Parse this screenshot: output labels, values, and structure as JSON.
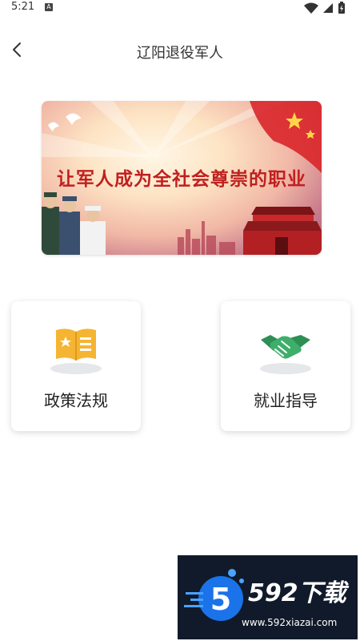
{
  "status_bar": {
    "time": "5:21",
    "notification_icon_letter": "A"
  },
  "header": {
    "title": "辽阳退役军人",
    "back_icon": "chevron-left-icon"
  },
  "banner": {
    "slogan": "让军人成为全社会尊崇的职业"
  },
  "cards": [
    {
      "label": "政策法规",
      "icon": "policy-book-icon",
      "icon_color": "#F5B532"
    },
    {
      "label": "就业指导",
      "icon": "handshake-icon",
      "icon_color": "#3FAE6A"
    }
  ],
  "watermark": {
    "brand": "592下载",
    "url": "www.592xiazai.com",
    "logo_digit": "5"
  },
  "colors": {
    "background": "#FFFFFF",
    "title_text": "#333333",
    "banner_slogan": "#C02020"
  }
}
